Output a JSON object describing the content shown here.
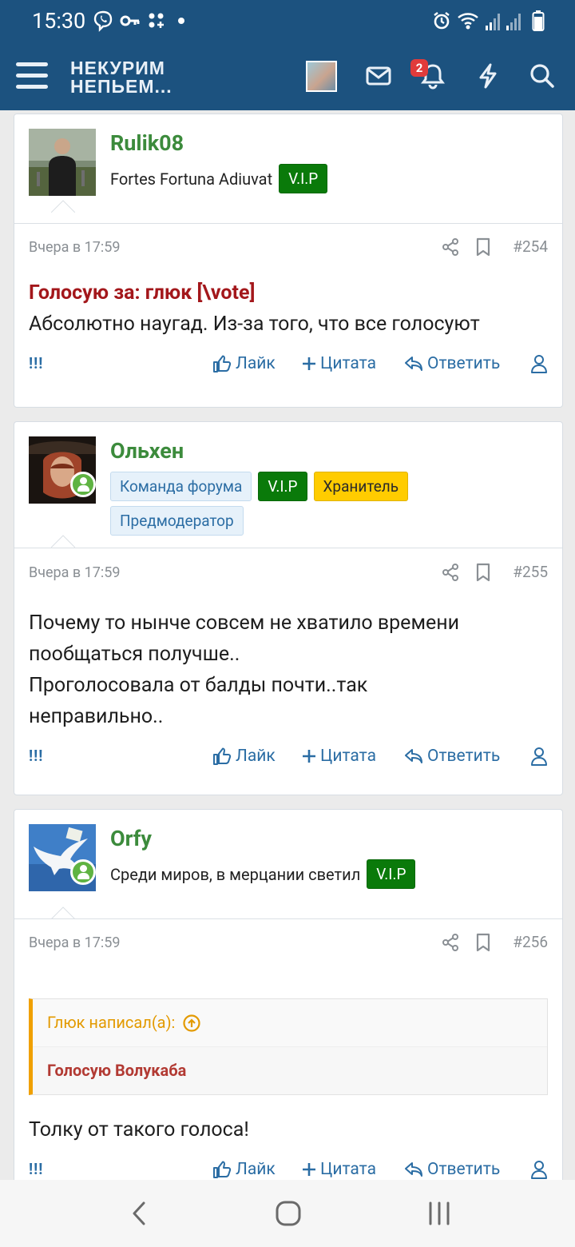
{
  "status": {
    "time": "15:30"
  },
  "header": {
    "logo_line1": "НЕКУРИМ",
    "logo_line2": "НЕПЬЕМ...",
    "notifications_count": "2"
  },
  "actions": {
    "like": "Лайк",
    "quote": "Цитата",
    "reply": "Ответить",
    "report": "!!!"
  },
  "posts": [
    {
      "username": "Rulik08",
      "user_title": "Fortes Fortuna Adiuvat",
      "badges": [
        "V.I.P"
      ],
      "date": "Вчера в 17:59",
      "number": "#254",
      "vote_line": "Голосую за: глюк [\\vote]",
      "text": "Абсолютно наугад. Из-за того, что все голосуют"
    },
    {
      "username": "Ольхен",
      "badges": [
        "Команда форума",
        "V.I.P",
        "Хранитель",
        "Предмодератор"
      ],
      "date": "Вчера в 17:59",
      "number": "#255",
      "text_lines": [
        "Почему то нынче совсем не хватило времени",
        "пообщаться получше..",
        "Проголосовала от балды почти..так",
        "неправильно.."
      ]
    },
    {
      "username": "Orfy",
      "user_title": "Среди миров, в мерцании светил",
      "badges": [
        "V.I.P"
      ],
      "date": "Вчера в 17:59",
      "number": "#256",
      "quote_author": "Глюк написал(а):",
      "quote_text": "Голосую Волукаба",
      "text": "Толку от такого голоса!"
    }
  ]
}
